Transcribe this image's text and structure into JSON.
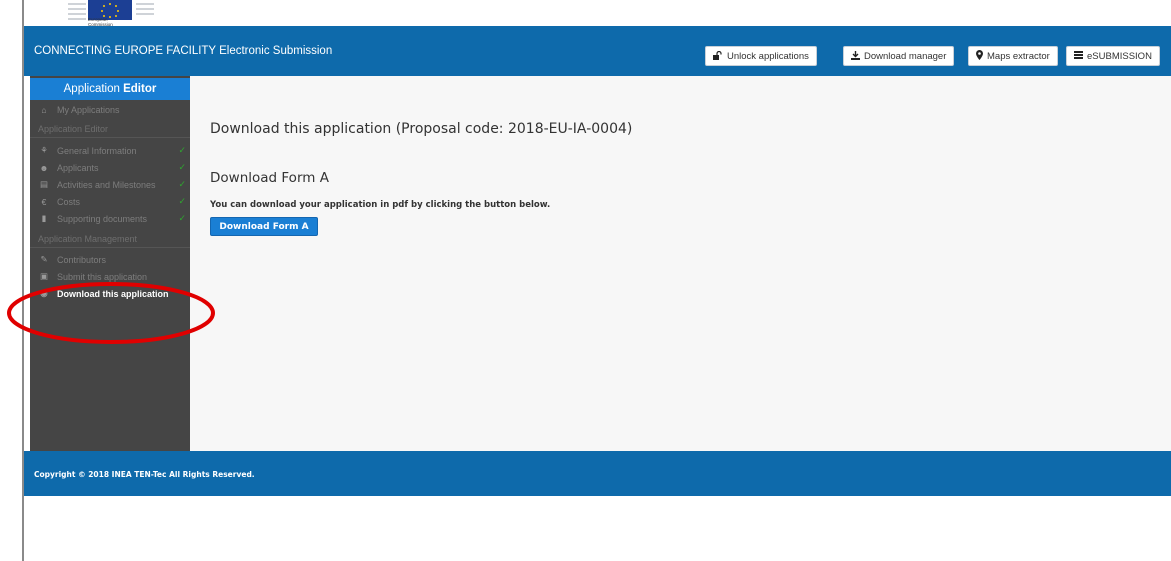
{
  "logo": {
    "line1": "European",
    "line2": "Commission"
  },
  "header": {
    "title": "CONNECTING EUROPE FACILITY Electronic Submission",
    "buttons": [
      {
        "label": "Unlock applications",
        "icon": "unlock-icon"
      },
      {
        "label": "Download manager",
        "icon": "download-icon"
      },
      {
        "label": "Maps extractor",
        "icon": "map-marker-icon"
      },
      {
        "label": "eSUBMISSION",
        "icon": "list-icon"
      }
    ]
  },
  "sidebar": {
    "title_prefix": "Application ",
    "title_bold": "Editor",
    "my_applications": "My Applications",
    "section_editor": "Application Editor",
    "editor_items": [
      {
        "label": "General Information",
        "complete": true
      },
      {
        "label": "Applicants",
        "complete": true
      },
      {
        "label": "Activities and Milestones",
        "complete": true
      },
      {
        "label": "Costs",
        "complete": true
      },
      {
        "label": "Supporting documents",
        "complete": true
      }
    ],
    "section_management": "Application Management",
    "management_items": [
      {
        "label": "Contributors"
      },
      {
        "label": "Submit this application"
      },
      {
        "label": "Download this application",
        "active": true
      }
    ],
    "check_mark": "✓"
  },
  "main": {
    "heading": "Download this application (Proposal code: 2018-EU-IA-0004)",
    "subheading": "Download Form A",
    "description": "You can download your application in pdf by clicking the button below.",
    "button_label": "Download Form A"
  },
  "footer": {
    "copyright": "Copyright © 2018 INEA TEN-Tec All Rights Reserved."
  },
  "colors": {
    "header_blue": "#0e6aab",
    "accent_blue": "#1a7fd4",
    "sidebar_bg": "#454545",
    "check_green": "#2fa52f",
    "annotation_red": "#e00000"
  }
}
